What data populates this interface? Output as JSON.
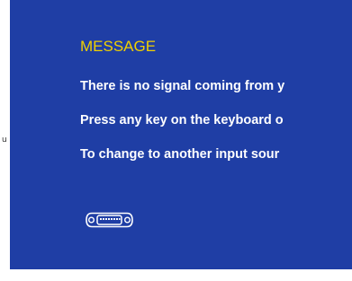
{
  "side_fragment": "u",
  "colors": {
    "screen_background": "#1f3ea5",
    "title": "#f0d000",
    "text": "#ffffff",
    "icon": "#ffffff"
  },
  "message": {
    "title": "MESSAGE",
    "lines": [
      "There is no signal coming from y",
      "Press any key on the keyboard o",
      "To change to another input sour"
    ]
  },
  "icons": {
    "connector": "dvi-connector-icon"
  }
}
